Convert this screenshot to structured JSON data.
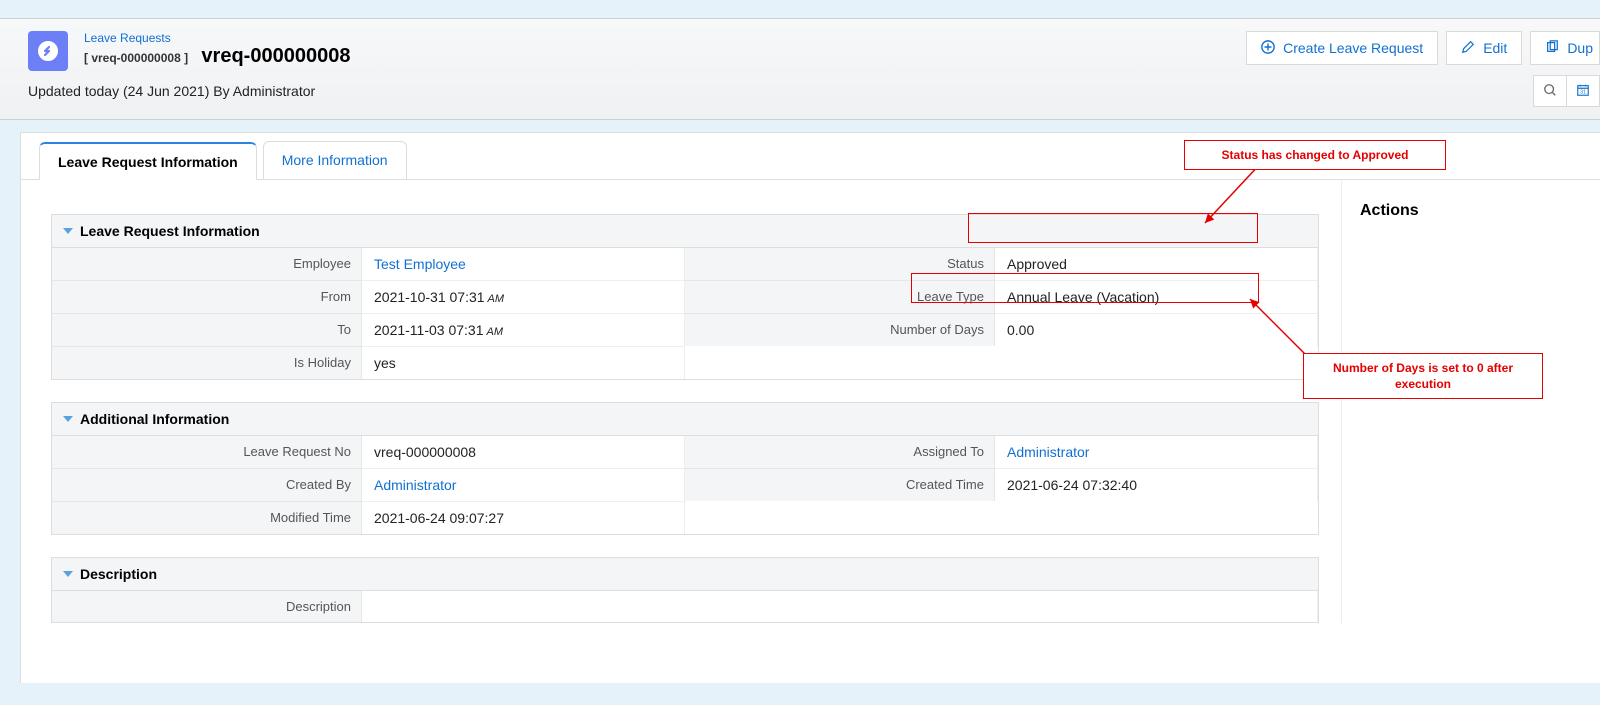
{
  "header": {
    "module": "Leave Requests",
    "record_id_bracket": "[ vreq-000000008 ]",
    "title": "vreq-000000008",
    "updated_text": "Updated today (24 Jun 2021) By Administrator",
    "buttons": {
      "create": "Create Leave Request",
      "edit": "Edit",
      "duplicate": "Dup"
    }
  },
  "tabs": {
    "t1": "Leave Request Information",
    "t2": "More Information"
  },
  "sections": {
    "info_title": "Leave Request Information",
    "addl_title": "Additional Information",
    "desc_title": "Description"
  },
  "info": {
    "employee_lbl": "Employee",
    "employee_val": "Test Employee",
    "from_lbl": "From",
    "from_val": "2021-10-31 07:31",
    "from_ampm": "AM",
    "to_lbl": "To",
    "to_val": "2021-11-03 07:31",
    "to_ampm": "AM",
    "holiday_lbl": "Is Holiday",
    "holiday_val": "yes",
    "status_lbl": "Status",
    "status_val": "Approved",
    "leavetype_lbl": "Leave Type",
    "leavetype_val": "Annual Leave (Vacation)",
    "numdays_lbl": "Number of Days",
    "numdays_val": "0.00"
  },
  "addl": {
    "reqno_lbl": "Leave Request No",
    "reqno_val": "vreq-000000008",
    "created_by_lbl": "Created By",
    "created_by_val": "Administrator",
    "modified_lbl": "Modified Time",
    "modified_val": "2021-06-24 09:07:27",
    "assigned_lbl": "Assigned To",
    "assigned_val": "Administrator",
    "created_time_lbl": "Created Time",
    "created_time_val": "2021-06-24 07:32:40"
  },
  "desc": {
    "lbl": "Description"
  },
  "actions": {
    "title": "Actions"
  },
  "annotations": {
    "a1": "Status has changed to Approved",
    "a2": "Number of Days is set to 0 after execution"
  }
}
